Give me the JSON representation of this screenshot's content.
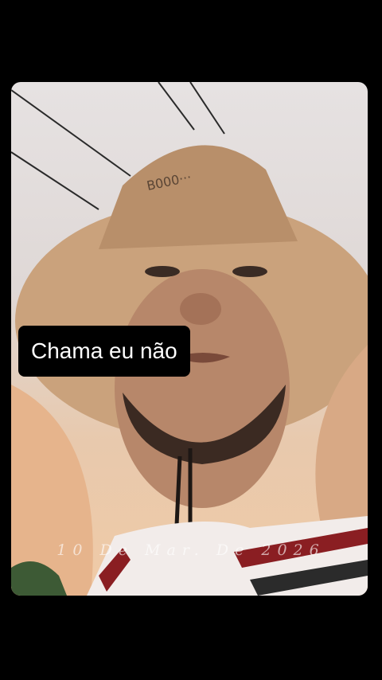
{
  "story": {
    "caption": "Chama eu não",
    "date_stamp": "10 De Mar. De 2026"
  },
  "photo": {
    "description_icon": "selfie-photo",
    "colors": {
      "sky": "#e4e0e0",
      "hat": "#c9a07a",
      "skin": "#b98566",
      "shirt_red": "#8a1e22"
    }
  }
}
